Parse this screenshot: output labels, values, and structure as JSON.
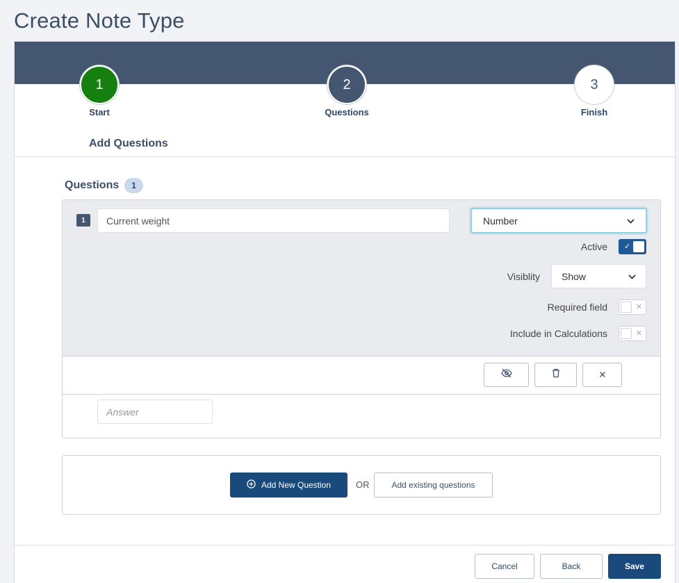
{
  "page": {
    "title": "Create Note Type"
  },
  "steps": [
    {
      "number": "1",
      "label": "Start",
      "state": "complete"
    },
    {
      "number": "2",
      "label": "Questions",
      "state": "current"
    },
    {
      "number": "3",
      "label": "Finish",
      "state": "upcoming"
    }
  ],
  "section": {
    "heading": "Add Questions"
  },
  "questions": {
    "title": "Questions",
    "count": "1",
    "items": [
      {
        "number": "1",
        "text": "Current weight",
        "type": "Number",
        "active_label": "Active",
        "active": true,
        "visibility_label": "Visiblity",
        "visibility_value": "Show",
        "required_label": "Required field",
        "required": false,
        "calculations_label": "Include in Calculations",
        "calculations": false,
        "answer_placeholder": "Answer"
      }
    ]
  },
  "add": {
    "new_question_label": "Add New Question",
    "or_label": "OR",
    "existing_label": "Add existing questions"
  },
  "footer": {
    "cancel_label": "Cancel",
    "back_label": "Back",
    "save_label": "Save"
  },
  "colors": {
    "band": "#455770",
    "step_complete": "#15800f",
    "primary_button": "#1a4a7c",
    "toggle_on": "#1f5a96"
  },
  "icons": [
    "eye-off-icon",
    "trash-icon",
    "close-icon",
    "plus-circle-icon",
    "chevron-down-icon",
    "check-icon"
  ]
}
